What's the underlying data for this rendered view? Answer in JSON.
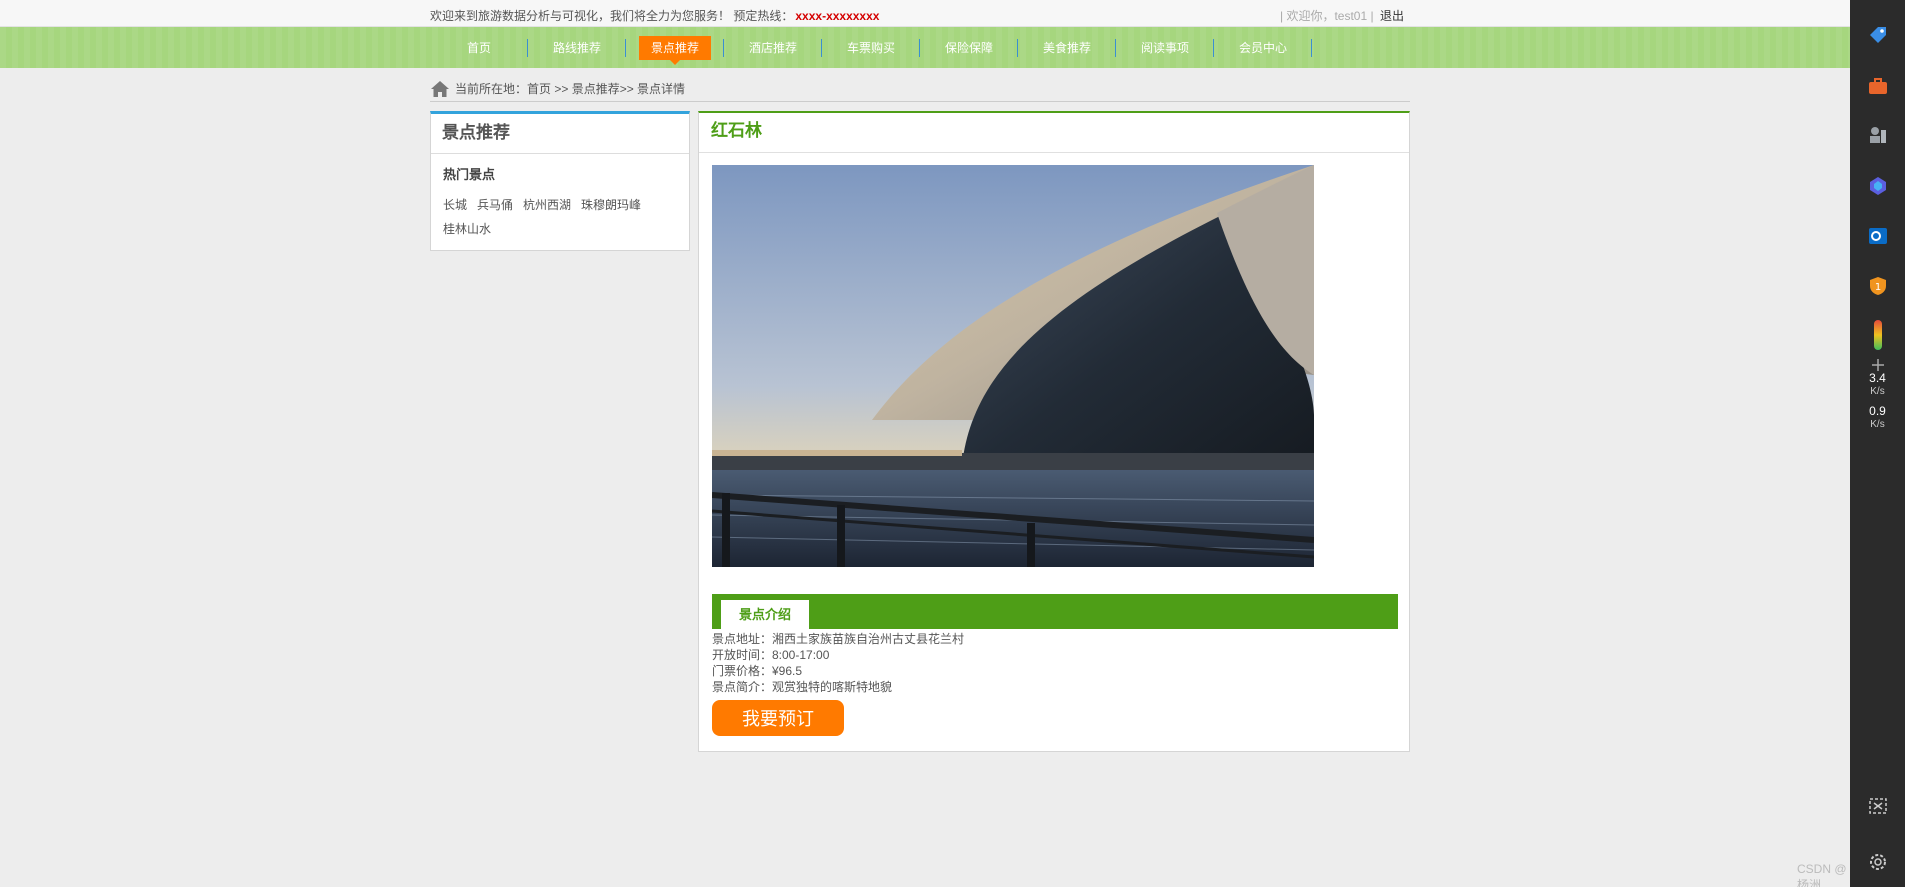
{
  "topbar": {
    "welcome": "欢迎来到旅游数据分析与可视化，我们将全力为您服务！",
    "hotline_label": "预定热线：",
    "hotline": "xxxx-xxxxxxxx",
    "user": "| 欢迎你，test01 |",
    "logout": "退出"
  },
  "nav": {
    "items": [
      {
        "label": "首页"
      },
      {
        "label": "路线推荐"
      },
      {
        "label": "景点推荐",
        "active": true
      },
      {
        "label": "酒店推荐"
      },
      {
        "label": "车票购买"
      },
      {
        "label": "保险保障"
      },
      {
        "label": "美食推荐"
      },
      {
        "label": "阅读事项"
      },
      {
        "label": "会员中心"
      }
    ]
  },
  "breadcrumb": {
    "prefix": "当前所在地：",
    "path": "首页 >> 景点推荐>> 景点详情"
  },
  "left_panel": {
    "title": "景点推荐",
    "subtitle": "热门景点",
    "tags": [
      "长城",
      "兵马俑",
      "杭州西湖",
      "珠穆朗玛峰",
      "桂林山水"
    ]
  },
  "detail": {
    "name": "红石林",
    "intro_tab": "景点介绍",
    "address": "景点地址：湘西土家族苗族自治州古丈县花兰村",
    "hours": "开放时间：8:00-17:00",
    "price": "门票价格：¥96.5",
    "summary": "景点简介：观赏独特的喀斯特地貌",
    "book_button": "我要预订"
  },
  "sidebar": {
    "upload_speed": "3.4",
    "upload_unit": "K/s",
    "download_speed": "0.9",
    "download_unit": "K/s",
    "icons": [
      "tag-icon",
      "toolbox-icon",
      "chess-icon",
      "copilot-icon",
      "outlook-icon",
      "shield-badge-icon",
      "thermometer-icon",
      "add-icon",
      "screenshot-icon",
      "settings-icon"
    ]
  },
  "watermark": "CSDN @杨洲",
  "colors": {
    "nav_bg": "#a6d67e",
    "accent_orange": "#ff7a00",
    "accent_green": "#4e9e17",
    "accent_blue": "#33a3dc",
    "hotline_red": "#d40000"
  }
}
